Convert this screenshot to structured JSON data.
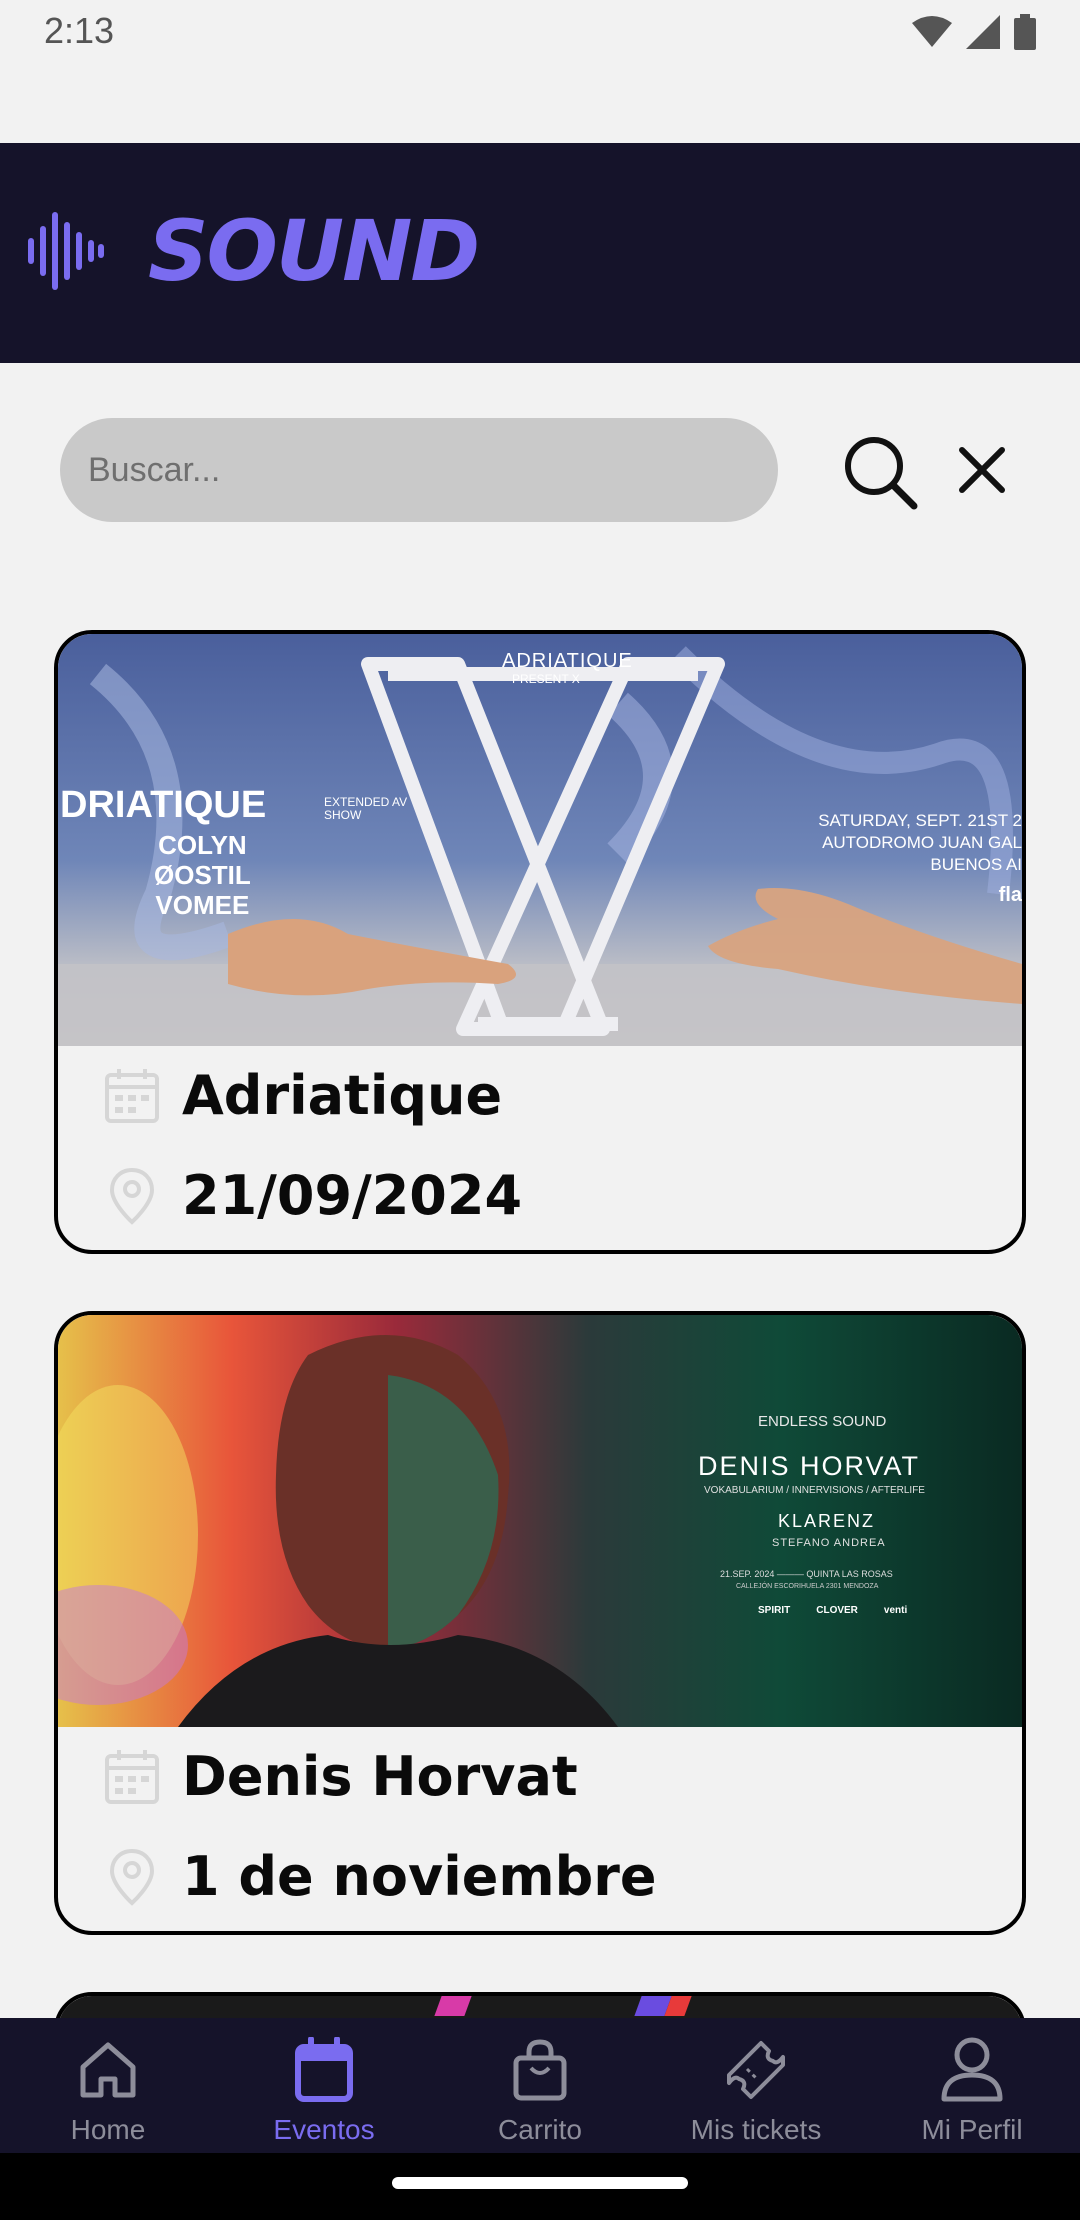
{
  "status_bar": {
    "time": "2:13",
    "icons": [
      "wifi-icon",
      "signal-icon",
      "battery-icon"
    ]
  },
  "header": {
    "logo_text": "SOUND",
    "logo_icon": "sound-wave-icon",
    "background_color": "#15132a",
    "accent_color": "#7a6cf0"
  },
  "search": {
    "placeholder": "Buscar...",
    "value": "",
    "search_icon": "search-icon",
    "clear_icon": "close-icon"
  },
  "events": [
    {
      "name": "Adriatique",
      "date": "21/09/2024",
      "date_icon": "calendar-icon",
      "location_icon": "location-pin-icon",
      "poster": {
        "brand": "ADRIATIQUE",
        "subtitle": "PRESENT X",
        "headline": "DRIATIQUE",
        "headline_tag": "EXTENDED AV SHOW",
        "lineup": [
          "COLYN",
          "ØOSTIL",
          "VOMEE"
        ],
        "right_lines": [
          "SATURDAY, SEPT. 21ST 2",
          "AUTODROMO JUAN GAL",
          "BUENOS AI"
        ],
        "sponsor": "fla"
      }
    },
    {
      "name": "Denis Horvat",
      "date": "1 de noviembre",
      "date_icon": "calendar-icon",
      "location_icon": "location-pin-icon",
      "poster": {
        "brand": "ENDLESS SOUND",
        "headline": "DENIS HORVAT",
        "tagline": "VOKABULARIUM / INNERVISIONS / AFTERLIFE",
        "support": "KLARENZ",
        "support2": "STEFANO ANDREA",
        "details": "21.SEP. 2024 ——— QUINTA LAS ROSAS",
        "address": "CALLEJÓN ESCORIHUELA 2301 MENDOZA",
        "sponsors": [
          "SPIRIT",
          "CLOVER",
          "venti"
        ]
      }
    }
  ],
  "bottom_nav": {
    "items": [
      {
        "label": "Home",
        "icon": "home-icon",
        "active": false
      },
      {
        "label": "Eventos",
        "icon": "calendar-icon",
        "active": true
      },
      {
        "label": "Carrito",
        "icon": "shopping-bag-icon",
        "active": false
      },
      {
        "label": "Mis tickets",
        "icon": "ticket-icon",
        "active": false
      },
      {
        "label": "Mi Perfil",
        "icon": "user-icon",
        "active": false
      }
    ]
  }
}
